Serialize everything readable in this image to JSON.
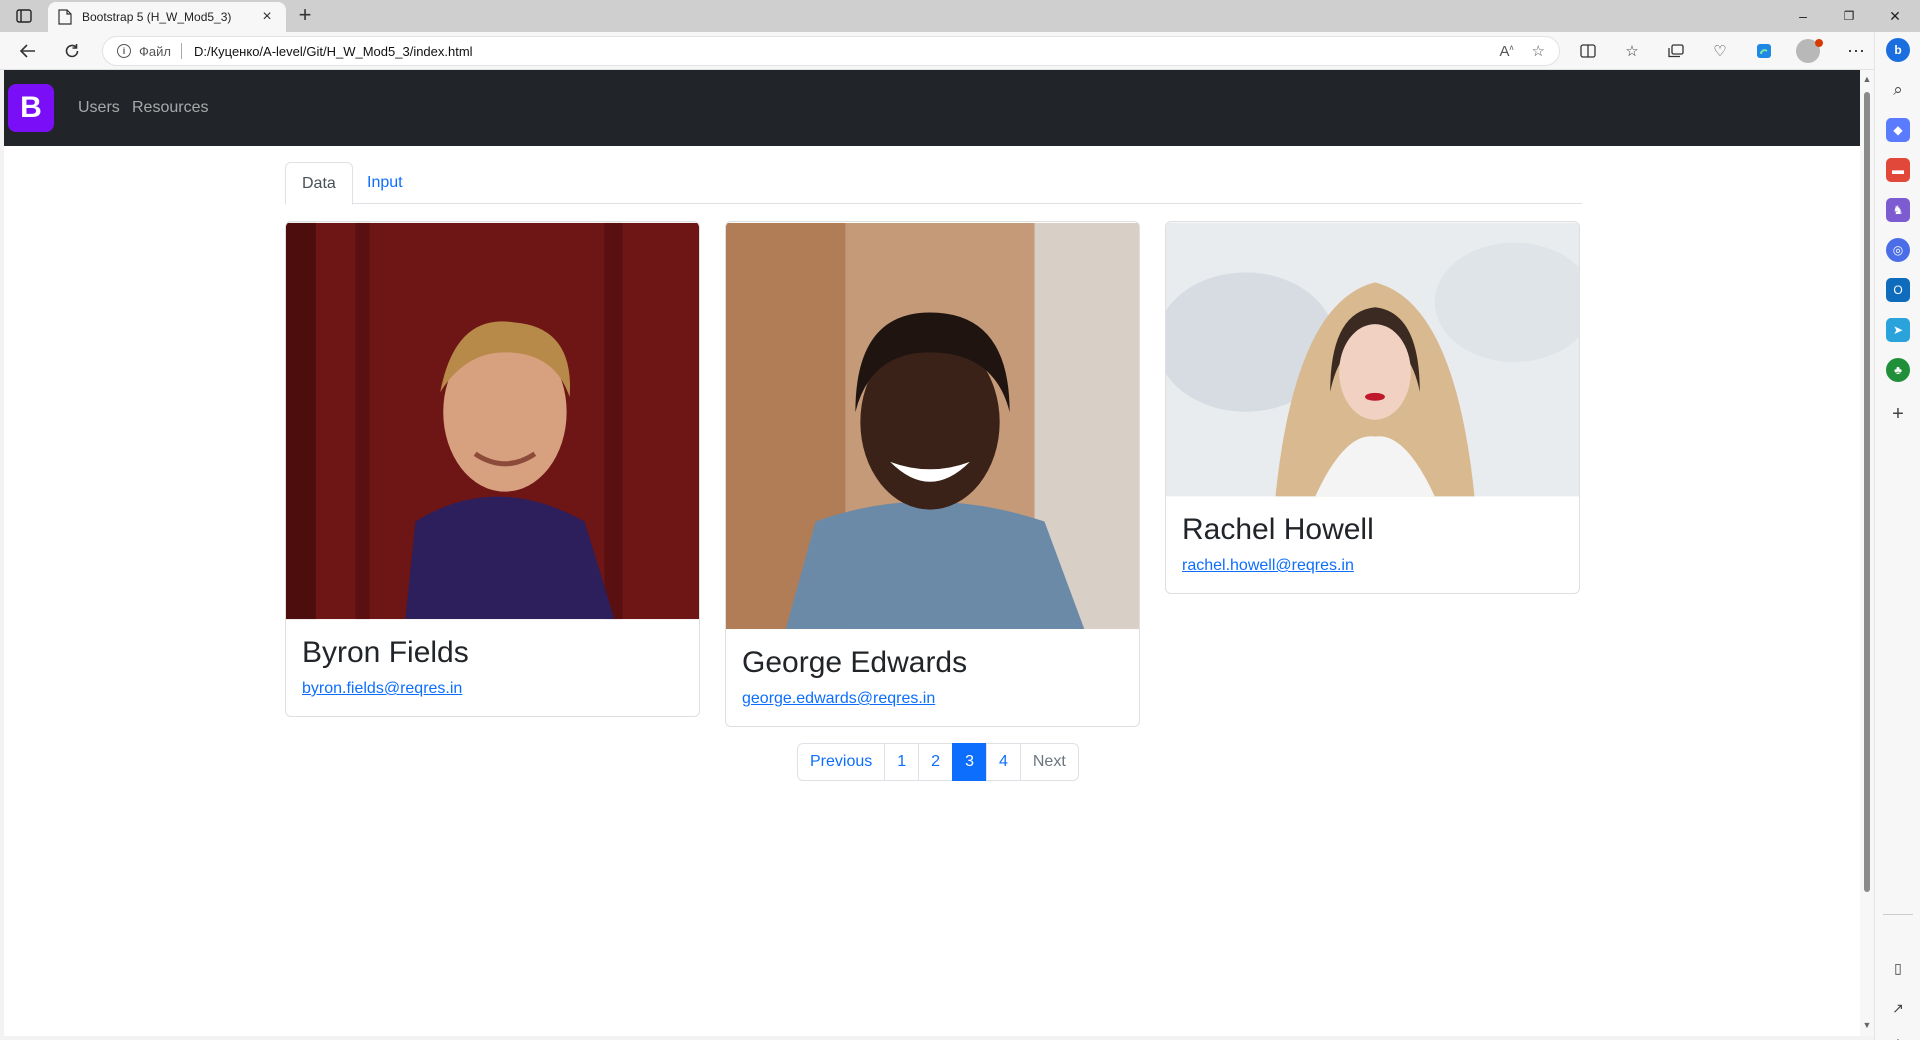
{
  "browser": {
    "tab_title": "Bootstrap 5 (H_W_Mod5_3)",
    "new_tab_symbol": "+",
    "close_symbol": "×",
    "scheme_label": "Файл",
    "url": "D:/Куценко/A-level/Git/H_W_Mod5_3/index.html",
    "window_controls": [
      "–",
      "❐",
      "✕"
    ]
  },
  "site": {
    "brand_letter": "B",
    "brand_color": "#7a0ff7",
    "nav_links": [
      "Users",
      "Resources"
    ],
    "tabs": [
      "Data",
      "Input"
    ]
  },
  "users": [
    {
      "name": "Byron Fields",
      "email": "byron.fields@reqres.in"
    },
    {
      "name": "George Edwards",
      "email": "george.edwards@reqres.in"
    },
    {
      "name": "Rachel Howell",
      "email": "rachel.howell@reqres.in"
    }
  ],
  "pagination": {
    "previous": "Previous",
    "pages": [
      "1",
      "2",
      "3",
      "4"
    ],
    "current": "3",
    "next": "Next"
  },
  "colors": {
    "accent": "#0d6efd",
    "navbar_bg": "#212529"
  },
  "sidebar_icons": [
    "search-icon",
    "tag-icon",
    "briefcase-icon",
    "games-icon",
    "office-icon",
    "outlook-icon",
    "telegram-icon",
    "tree-icon",
    "add-icon",
    "split-screen-icon",
    "external-link-icon",
    "settings-icon"
  ]
}
